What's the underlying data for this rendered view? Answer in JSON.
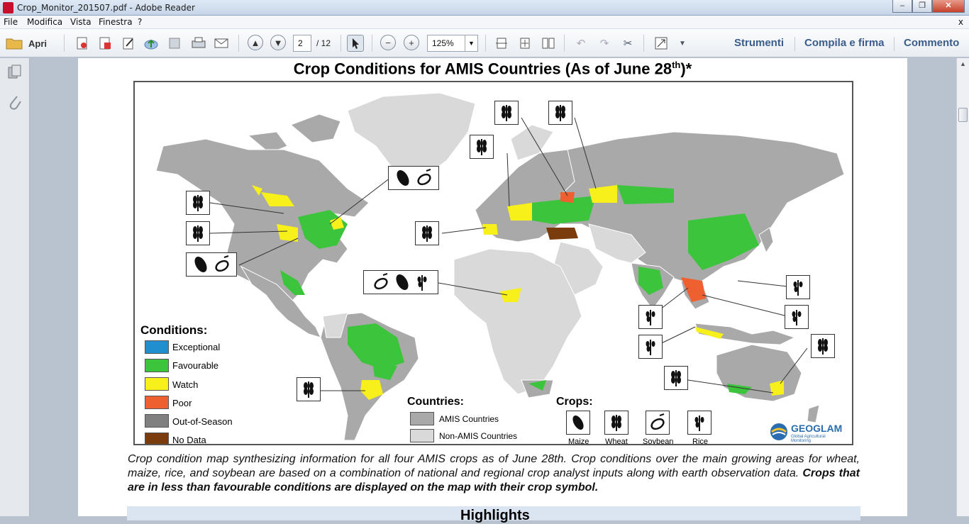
{
  "window": {
    "title": "Crop_Monitor_201507.pdf - Adobe Reader",
    "minimize": "‒",
    "maximize": "❐",
    "close": "✕",
    "close_doc": "x"
  },
  "menu": [
    "File",
    "Modifica",
    "Vista",
    "Finestra",
    "?"
  ],
  "toolbar": {
    "open_label": "Apri",
    "page_current": "2",
    "page_total": "/ 12",
    "zoom": "125%",
    "tools_label": "Strumenti",
    "fill_sign_label": "Compila e firma",
    "comment_label": "Commento"
  },
  "document": {
    "title_main": "Crop Conditions for AMIS Countries (As of June 28",
    "title_sup": "th",
    "title_end": ")*",
    "caption_part1": "Crop condition map synthesizing information for all four AMIS crops as of June 28th.  Crop conditions over the main growing areas for wheat, maize, rice, and soybean are based on a combination of national and regional crop analyst inputs along with earth observation data.",
    "caption_bold": "Crops that are in less than favourable conditions are displayed on the map with their crop symbol.",
    "highlights": "Highlights"
  },
  "legend": {
    "conditions_title": "Conditions:",
    "conditions": [
      {
        "label": "Exceptional",
        "color": "#1f8fd0"
      },
      {
        "label": "Favourable",
        "color": "#3cc43c"
      },
      {
        "label": "Watch",
        "color": "#f7f01a"
      },
      {
        "label": "Poor",
        "color": "#ef6030"
      },
      {
        "label": "Out-of-Season",
        "color": "#808080"
      },
      {
        "label": "No Data",
        "color": "#7a3b0d"
      }
    ],
    "countries_title": "Countries:",
    "countries": [
      {
        "label": "AMIS Countries",
        "color": "#a9a9a9"
      },
      {
        "label": "Non-AMIS Countries",
        "color": "#d9d9d9"
      }
    ],
    "crops_title": "Crops:",
    "crops": [
      {
        "label": "Maize",
        "icon": "maize-icon"
      },
      {
        "label": "Wheat",
        "icon": "wheat-icon"
      },
      {
        "label": "Soybean",
        "icon": "soybean-icon"
      },
      {
        "label": "Rice",
        "icon": "rice-icon"
      }
    ],
    "logo_name": "GEOGLAM",
    "logo_sub": "Global Agricultural Monitoring"
  }
}
